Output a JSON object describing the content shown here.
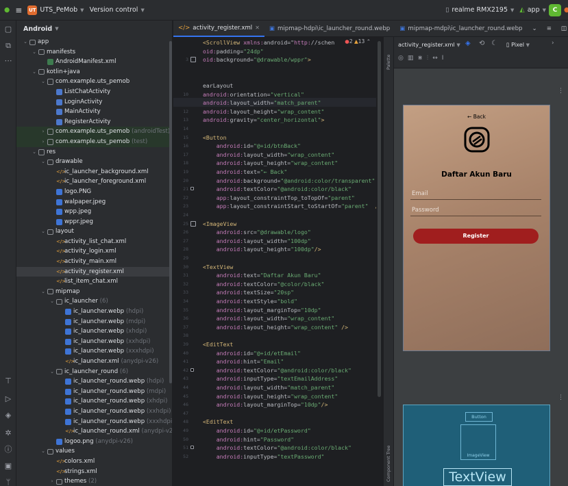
{
  "titlebar": {
    "menu_icon": "hamburger-icon",
    "project_badge": "UT",
    "project_name": "UTS_PeMob",
    "vcs": "Version control",
    "device": "realme RMX2195",
    "run_config": "app",
    "run_icon": "C"
  },
  "project_panel": {
    "view": "Android",
    "rows": [
      {
        "label": "app",
        "suffix": "",
        "icon": "folder",
        "level": 0,
        "arrow": "v"
      },
      {
        "label": "manifests",
        "suffix": "",
        "icon": "folder",
        "level": 1,
        "arrow": "v"
      },
      {
        "label": "AndroidManifest.xml",
        "suffix": "",
        "icon": "mani",
        "level": 2,
        "arrow": ""
      },
      {
        "label": "kotlin+java",
        "suffix": "",
        "icon": "folder",
        "level": 1,
        "arrow": "v"
      },
      {
        "label": "com.example.uts_pemob",
        "suffix": "",
        "icon": "pkg",
        "level": 2,
        "arrow": "v"
      },
      {
        "label": "ListChatActivity",
        "suffix": "",
        "icon": "kotlin",
        "level": 3,
        "arrow": ""
      },
      {
        "label": "LoginActivity",
        "suffix": "",
        "icon": "kotlin",
        "level": 3,
        "arrow": ""
      },
      {
        "label": "MainActivity",
        "suffix": "",
        "icon": "kotlin",
        "level": 3,
        "arrow": ""
      },
      {
        "label": "RegisterActivity",
        "suffix": "",
        "icon": "kotlin",
        "level": 3,
        "arrow": ""
      },
      {
        "label": "com.example.uts_pemob",
        "suffix": " (androidTest)",
        "icon": "pkg",
        "level": 2,
        "arrow": ">",
        "green": true
      },
      {
        "label": "com.example.uts_pemob",
        "suffix": " (test)",
        "icon": "pkg",
        "level": 2,
        "arrow": ">",
        "green": true
      },
      {
        "label": "res",
        "suffix": "",
        "icon": "res",
        "level": 1,
        "arrow": "v"
      },
      {
        "label": "drawable",
        "suffix": "",
        "icon": "folder",
        "level": 2,
        "arrow": "v"
      },
      {
        "label": "ic_launcher_background.xml",
        "suffix": "",
        "icon": "xml",
        "level": 3,
        "arrow": ""
      },
      {
        "label": "ic_launcher_foreground.xml",
        "suffix": "",
        "icon": "xml",
        "level": 3,
        "arrow": ""
      },
      {
        "label": "logo.PNG",
        "suffix": "",
        "icon": "img",
        "level": 3,
        "arrow": ""
      },
      {
        "label": "walpaper.jpeg",
        "suffix": "",
        "icon": "img",
        "level": 3,
        "arrow": ""
      },
      {
        "label": "wpp.jpeg",
        "suffix": "",
        "icon": "img",
        "level": 3,
        "arrow": ""
      },
      {
        "label": "wppr.jpeg",
        "suffix": "",
        "icon": "img",
        "level": 3,
        "arrow": ""
      },
      {
        "label": "layout",
        "suffix": "",
        "icon": "folder",
        "level": 2,
        "arrow": "v"
      },
      {
        "label": "activity_list_chat.xml",
        "suffix": "",
        "icon": "xml",
        "level": 3,
        "arrow": ""
      },
      {
        "label": "activity_login.xml",
        "suffix": "",
        "icon": "xml",
        "level": 3,
        "arrow": ""
      },
      {
        "label": "activity_main.xml",
        "suffix": "",
        "icon": "xml",
        "level": 3,
        "arrow": ""
      },
      {
        "label": "activity_register.xml",
        "suffix": "",
        "icon": "xml",
        "level": 3,
        "arrow": "",
        "selected": true
      },
      {
        "label": "list_item_chat.xml",
        "suffix": "",
        "icon": "xml",
        "level": 3,
        "arrow": ""
      },
      {
        "label": "mipmap",
        "suffix": "",
        "icon": "folder",
        "level": 2,
        "arrow": "v"
      },
      {
        "label": "ic_launcher",
        "suffix": " (6)",
        "icon": "folder",
        "level": 3,
        "arrow": "v"
      },
      {
        "label": "ic_launcher.webp",
        "suffix": " (hdpi)",
        "icon": "img",
        "level": 4,
        "arrow": ""
      },
      {
        "label": "ic_launcher.webp",
        "suffix": " (mdpi)",
        "icon": "img",
        "level": 4,
        "arrow": ""
      },
      {
        "label": "ic_launcher.webp",
        "suffix": " (xhdpi)",
        "icon": "img",
        "level": 4,
        "arrow": ""
      },
      {
        "label": "ic_launcher.webp",
        "suffix": " (xxhdpi)",
        "icon": "img",
        "level": 4,
        "arrow": ""
      },
      {
        "label": "ic_launcher.webp",
        "suffix": " (xxxhdpi)",
        "icon": "img",
        "level": 4,
        "arrow": ""
      },
      {
        "label": "ic_launcher.xml",
        "suffix": " (anydpi-v26)",
        "icon": "xml",
        "level": 4,
        "arrow": ""
      },
      {
        "label": "ic_launcher_round",
        "suffix": " (6)",
        "icon": "folder",
        "level": 3,
        "arrow": "v"
      },
      {
        "label": "ic_launcher_round.webp",
        "suffix": " (hdpi)",
        "icon": "img",
        "level": 4,
        "arrow": ""
      },
      {
        "label": "ic_launcher_round.webp",
        "suffix": " (mdpi)",
        "icon": "img",
        "level": 4,
        "arrow": ""
      },
      {
        "label": "ic_launcher_round.webp",
        "suffix": " (xhdpi)",
        "icon": "img",
        "level": 4,
        "arrow": ""
      },
      {
        "label": "ic_launcher_round.webp",
        "suffix": " (xxhdpi)",
        "icon": "img",
        "level": 4,
        "arrow": ""
      },
      {
        "label": "ic_launcher_round.webp",
        "suffix": " (xxxhdpi)",
        "icon": "img",
        "level": 4,
        "arrow": ""
      },
      {
        "label": "ic_launcher_round.xml",
        "suffix": " (anydpi-v26)",
        "icon": "xml",
        "level": 4,
        "arrow": ""
      },
      {
        "label": "logoo.png",
        "suffix": " (anydpi-v26)",
        "icon": "img",
        "level": 3,
        "arrow": ""
      },
      {
        "label": "values",
        "suffix": "",
        "icon": "folder",
        "level": 2,
        "arrow": "v"
      },
      {
        "label": "colors.xml",
        "suffix": "",
        "icon": "xml",
        "level": 3,
        "arrow": ""
      },
      {
        "label": "strings.xml",
        "suffix": "",
        "icon": "xml",
        "level": 3,
        "arrow": ""
      },
      {
        "label": "themes",
        "suffix": " (2)",
        "icon": "folder",
        "level": 3,
        "arrow": ">"
      }
    ]
  },
  "tabs": [
    {
      "label": "activity_register.xml",
      "active": true
    },
    {
      "label": "mipmap-hdpi\\ic_launcher_round.webp",
      "active": false
    },
    {
      "label": "mipmap-mdpi\\ic_launcher_round.webp",
      "active": false
    }
  ],
  "editor": {
    "warnings": "2",
    "weak_warnings": "13",
    "lines": [
      {
        "n": "",
        "t": "<ScrollView xmlns:android=\"http://schen",
        "c": "tag"
      },
      {
        "n": "",
        "t": "oid:padding=\"24dp\"",
        "c": "attr"
      },
      {
        "n": "3",
        "t": "oid:background=\"@drawable/wppr\">",
        "c": "attr",
        "icon": true
      },
      {
        "n": "",
        "t": "",
        "c": "attr"
      },
      {
        "n": "",
        "t": "",
        "c": "attr"
      },
      {
        "n": "",
        "t": "earLayout",
        "c": "tag"
      },
      {
        "n": "10",
        "t": "android:orientation=\"vertical\"",
        "c": "attr"
      },
      {
        "n": "11",
        "t": "android:layout_width=\"match_parent\"",
        "c": "attr",
        "cur": true
      },
      {
        "n": "12",
        "t": "android:layout_height=\"wrap_content\"",
        "c": "attr"
      },
      {
        "n": "13",
        "t": "android:gravity=\"center_horizontal\">",
        "c": "attr"
      },
      {
        "n": "14",
        "t": "",
        "c": "attr"
      },
      {
        "n": "15",
        "t": "<Button",
        "c": "tag"
      },
      {
        "n": "16",
        "t": "    android:id=\"@+id/btnBack\"",
        "c": "attr"
      },
      {
        "n": "17",
        "t": "    android:layout_width=\"wrap_content\"",
        "c": "attr"
      },
      {
        "n": "18",
        "t": "    android:layout_height=\"wrap_content\"",
        "c": "attr"
      },
      {
        "n": "19",
        "t": "    android:text=\"← Back\"",
        "c": "attr"
      },
      {
        "n": "20",
        "t": "    android:background=\"@android:color/transparent\"",
        "c": "attr"
      },
      {
        "n": "21",
        "t": "    android:textColor=\"@android:color/black\"",
        "c": "attr",
        "sq": true
      },
      {
        "n": "22",
        "t": "    app:layout_constraintTop_toTopOf=\"parent\"",
        "c": "attr"
      },
      {
        "n": "23",
        "t": "    app:layout_constraintStart_toStartOf=\"parent\"  />",
        "c": "attr"
      },
      {
        "n": "24",
        "t": "",
        "c": "attr"
      },
      {
        "n": "25",
        "t": "<ImageView",
        "c": "tag",
        "icon": true
      },
      {
        "n": "26",
        "t": "    android:src=\"@drawable/logo\"",
        "c": "attr"
      },
      {
        "n": "27",
        "t": "    android:layout_width=\"100dp\"",
        "c": "attr"
      },
      {
        "n": "28",
        "t": "    android:layout_height=\"100dp\"/>",
        "c": "attr"
      },
      {
        "n": "29",
        "t": "",
        "c": "attr"
      },
      {
        "n": "30",
        "t": "<TextView",
        "c": "tag"
      },
      {
        "n": "31",
        "t": "    android:text=\"Daftar Akun Baru\"",
        "c": "attr"
      },
      {
        "n": "32",
        "t": "    android:textColor=\"@color/black\"",
        "c": "attr"
      },
      {
        "n": "33",
        "t": "    android:textSize=\"20sp\"",
        "c": "attr"
      },
      {
        "n": "34",
        "t": "    android:textStyle=\"bold\"",
        "c": "attr"
      },
      {
        "n": "35",
        "t": "    android:layout_marginTop=\"10dp\"",
        "c": "attr"
      },
      {
        "n": "36",
        "t": "    android:layout_width=\"wrap_content\"",
        "c": "attr"
      },
      {
        "n": "37",
        "t": "    android:layout_height=\"wrap_content\" />",
        "c": "attr"
      },
      {
        "n": "38",
        "t": "",
        "c": "attr"
      },
      {
        "n": "39",
        "t": "<EditText",
        "c": "tag"
      },
      {
        "n": "40",
        "t": "    android:id=\"@+id/etEmail\"",
        "c": "attr"
      },
      {
        "n": "41",
        "t": "    android:hint=\"Email\"",
        "c": "attr"
      },
      {
        "n": "42",
        "t": "    android:textColor=\"@android:color/black\"",
        "c": "attr",
        "sq": true
      },
      {
        "n": "43",
        "t": "    android:inputType=\"textEmailAddress\"",
        "c": "attr"
      },
      {
        "n": "44",
        "t": "    android:layout_width=\"match_parent\"",
        "c": "attr"
      },
      {
        "n": "45",
        "t": "    android:layout_height=\"wrap_content\"",
        "c": "attr"
      },
      {
        "n": "46",
        "t": "    android:layout_marginTop=\"10dp\"/>",
        "c": "attr"
      },
      {
        "n": "47",
        "t": "",
        "c": "attr"
      },
      {
        "n": "48",
        "t": "<EditText",
        "c": "tag"
      },
      {
        "n": "49",
        "t": "    android:id=\"@+id/etPassword\"",
        "c": "attr"
      },
      {
        "n": "50",
        "t": "    android:hint=\"Password\"",
        "c": "attr"
      },
      {
        "n": "51",
        "t": "    android:textColor=\"@android:color/black\"",
        "c": "attr",
        "sq": true
      },
      {
        "n": "52",
        "t": "    android:inputType=\"textPassword\"",
        "c": "attr"
      }
    ]
  },
  "side_labels": {
    "palette": "Palette",
    "component_tree": "Component Tree"
  },
  "design": {
    "file_dropdown": "activity_register.xml",
    "device_dropdown": "Pixel",
    "more": "⋮",
    "phone": {
      "back": "← Back",
      "title": "Daftar Akun Baru",
      "email_hint": "Email",
      "password_hint": "Password",
      "register": "Register"
    },
    "blueprint": {
      "button": "Button",
      "imageview": "ImageView",
      "textview": "TextView"
    }
  }
}
